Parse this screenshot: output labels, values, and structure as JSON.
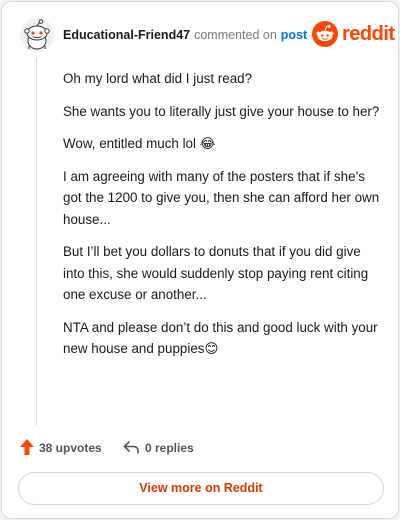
{
  "header": {
    "author": "Educational-Friend47",
    "commented_text": "commented on",
    "post_link": "post",
    "brand_name": "reddit"
  },
  "comment": {
    "paragraphs": [
      "Oh my lord what did I just read?",
      "She wants you to literally just give your house to her?",
      "Wow, entitled much lol 😂",
      "I am agreeing with many of the posters that if she’s got the 1200 to give you, then she can afford her own house...",
      "But I’ll bet you dollars to donuts that if you did give into this, she would suddenly stop paying rent citing one excuse or another...",
      "NTA and please don’t do this and good luck with your new house and puppies😊"
    ]
  },
  "actions": {
    "upvotes": "38 upvotes",
    "replies": "0 replies",
    "upvote_icon": "up-arrow-icon",
    "reply_icon": "reply-arrow-icon"
  },
  "footer": {
    "more_label": "View more on Reddit"
  },
  "colors": {
    "brand": "#ff4500",
    "link": "#0079d3",
    "upvote": "#ff4500",
    "cta_text": "#d93a00"
  }
}
